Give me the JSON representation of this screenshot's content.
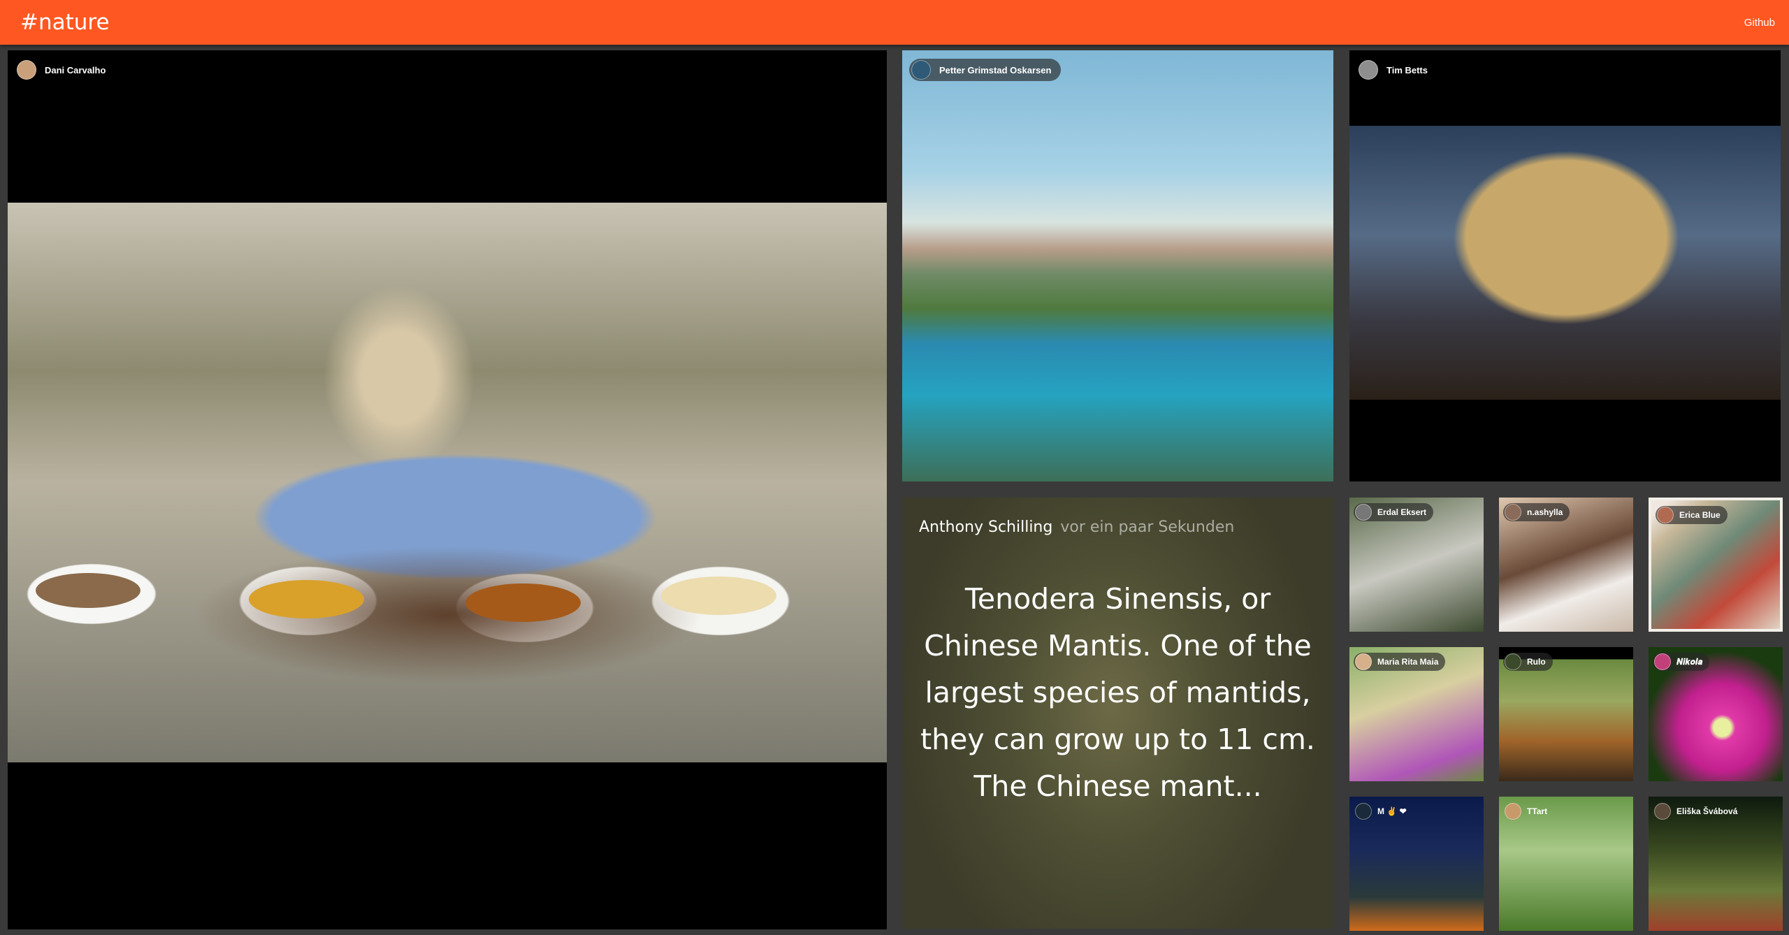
{
  "app": {
    "title": "#nature",
    "github_label": "Github"
  },
  "tiles": {
    "food": {
      "author": "Dani Carvalho"
    },
    "fjord": {
      "author": "Petter Grimstad Oskarsen"
    },
    "building": {
      "author": "Tim Betts"
    },
    "text_post": {
      "author": "Anthony Schilling",
      "time": "vor ein paar Sekunden",
      "body": "Tenodera Sinensis, or Chinese Mantis. One of the largest species of mantids, they can grow up to 11 cm. The Chinese mant..."
    },
    "small": [
      {
        "author": "Erdal Eksert"
      },
      {
        "author": "n.ashylla"
      },
      {
        "author": "Erica Blue"
      },
      {
        "author": "Maria Rita Maia"
      },
      {
        "author": "Rulo"
      },
      {
        "author": "𝑵𝒊𝒌𝒐𝒍𝒂"
      },
      {
        "author": "M ✌ ❤"
      },
      {
        "author": "TTart"
      },
      {
        "author": "Eliška Švábová"
      }
    ]
  },
  "colors": {
    "topbar": "#ff5722",
    "background": "#3a3a3a"
  }
}
